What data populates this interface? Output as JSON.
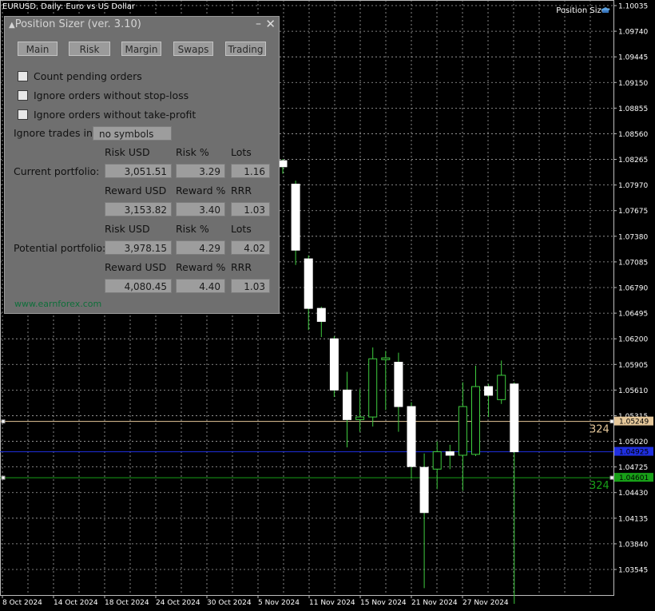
{
  "chart_title": "EURUSD, Daily: Euro vs US Dollar",
  "indicator_label": "Position Sizer",
  "panel": {
    "title": "Position Sizer (ver. 3.10)",
    "minimize": "▲",
    "close": "✕",
    "tabs": [
      "Main",
      "Risk",
      "Margin",
      "Swaps",
      "Trading"
    ],
    "checkboxes": [
      {
        "label": "Count pending orders",
        "checked": false
      },
      {
        "label": "Ignore orders without stop-loss",
        "checked": false
      },
      {
        "label": "Ignore orders without take-profit",
        "checked": false
      }
    ],
    "ignore_trades_label": "Ignore trades in",
    "ignore_trades_value": "no symbols",
    "current_label": "Current portfolio:",
    "potential_label": "Potential portfolio:",
    "headers_risk": [
      "Risk USD",
      "Risk %",
      "Lots"
    ],
    "headers_reward": [
      "Reward USD",
      "Reward %",
      "RRR"
    ],
    "current_risk": [
      "3,051.51",
      "3.29",
      "1.16"
    ],
    "current_reward": [
      "3,153.82",
      "3.40",
      "1.03"
    ],
    "potential_risk": [
      "3,978.15",
      "4.29",
      "4.02"
    ],
    "potential_reward": [
      "4,080.45",
      "4.40",
      "1.03"
    ],
    "website": "www.earnforex.com"
  },
  "chart_data": {
    "type": "candlestick",
    "y_ticks": [
      "1.10035",
      "1.09740",
      "1.09445",
      "1.09150",
      "1.08855",
      "1.08560",
      "1.08265",
      "1.07970",
      "1.07675",
      "1.07380",
      "1.07085",
      "1.06790",
      "1.06495",
      "1.06200",
      "1.05905",
      "1.05610",
      "1.05315",
      "1.05020",
      "1.04725",
      "1.04430",
      "1.04135",
      "1.03840",
      "1.03545"
    ],
    "y_values": [
      1.10035,
      1.0974,
      1.09445,
      1.0915,
      1.08855,
      1.0856,
      1.08265,
      1.0797,
      1.07675,
      1.0738,
      1.07085,
      1.0679,
      1.06495,
      1.062,
      1.05905,
      1.0561,
      1.05315,
      1.0502,
      1.04725,
      1.0443,
      1.04135,
      1.0384,
      1.03545
    ],
    "x_ticks": [
      "8 Oct 2024",
      "14 Oct 2024",
      "18 Oct 2024",
      "24 Oct 2024",
      "30 Oct 2024",
      "5 Nov 2024",
      "11 Nov 2024",
      "15 Nov 2024",
      "21 Nov 2024",
      "27 Nov 2024"
    ],
    "candles": [
      {
        "o": 1.0825,
        "h": 1.0827,
        "l": 1.081,
        "c": 1.0818
      },
      {
        "o": 1.0798,
        "h": 1.0802,
        "l": 1.0705,
        "c": 1.0722
      },
      {
        "o": 1.0712,
        "h": 1.0716,
        "l": 1.063,
        "c": 1.0655
      },
      {
        "o": 1.0655,
        "h": 1.0657,
        "l": 1.0622,
        "c": 1.064
      },
      {
        "o": 1.062,
        "h": 1.0623,
        "l": 1.0553,
        "c": 1.0561
      },
      {
        "o": 1.0561,
        "h": 1.0582,
        "l": 1.0495,
        "c": 1.0527
      },
      {
        "o": 1.0527,
        "h": 1.0562,
        "l": 1.0513,
        "c": 1.053
      },
      {
        "o": 1.053,
        "h": 1.061,
        "l": 1.0519,
        "c": 1.0597
      },
      {
        "o": 1.0596,
        "h": 1.0606,
        "l": 1.0538,
        "c": 1.0598
      },
      {
        "o": 1.0593,
        "h": 1.0604,
        "l": 1.0513,
        "c": 1.0542
      },
      {
        "o": 1.0542,
        "h": 1.0547,
        "l": 1.0459,
        "c": 1.0473
      },
      {
        "o": 1.0472,
        "h": 1.0488,
        "l": 1.0333,
        "c": 1.042
      },
      {
        "o": 1.047,
        "h": 1.0502,
        "l": 1.0447,
        "c": 1.049
      },
      {
        "o": 1.049,
        "h": 1.0498,
        "l": 1.047,
        "c": 1.0486
      },
      {
        "o": 1.0486,
        "h": 1.057,
        "l": 1.0445,
        "c": 1.0542
      },
      {
        "o": 1.0487,
        "h": 1.0589,
        "l": 1.0485,
        "c": 1.0565
      },
      {
        "o": 1.0565,
        "h": 1.0568,
        "l": 1.053,
        "c": 1.0555
      },
      {
        "o": 1.055,
        "h": 1.0595,
        "l": 1.0545,
        "c": 1.0578
      },
      {
        "o": 1.0568,
        "h": 1.057,
        "l": 1.0315,
        "c": 1.049
      }
    ],
    "lines": [
      {
        "name": "take-profit",
        "price": 1.05249,
        "label": "1.05249",
        "color": "#e6c89a",
        "tag": "324"
      },
      {
        "name": "entry",
        "price": 1.049,
        "label": "1.04925",
        "color": "#1f2fe0",
        "tag": ""
      },
      {
        "name": "stop-loss",
        "price": 1.04601,
        "label": "1.04601",
        "color": "#18a018",
        "tag": "324"
      }
    ],
    "grid": true,
    "grid_color": "#a8a8a8",
    "bull_color": "#ffffff",
    "bear_color": "#ffffff",
    "wick_color": "#3fcc3f"
  }
}
